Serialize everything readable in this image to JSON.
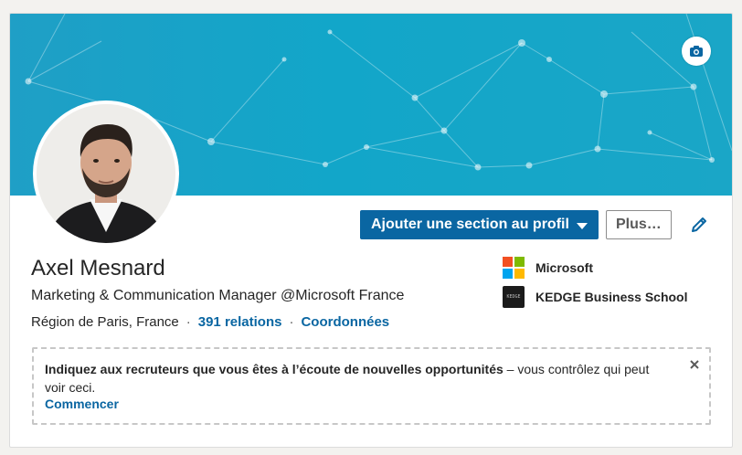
{
  "profile": {
    "name": "Axel Mesnard",
    "headline": "Marketing & Communication Manager @Microsoft France",
    "location": "Région de Paris, France",
    "relations": "391 relations",
    "contact_link": "Coordonnées",
    "separator": "·"
  },
  "actions": {
    "add_section_label": "Ajouter une section au profil",
    "more_label": "Plus…"
  },
  "companies": [
    {
      "label": "Microsoft",
      "icon": "microsoft-logo-icon"
    },
    {
      "label": "KEDGE Business School",
      "icon": "kedge-logo-icon",
      "logo_text": "KEDGE"
    }
  ],
  "opportunities": {
    "bold_text": "Indiquez aux recruteurs que vous êtes à l’écoute de nouvelles opportunités",
    "rest_text": " – vous contrôlez qui peut voir ceci.",
    "cta": "Commencer"
  },
  "colors": {
    "accent": "#0a66a2",
    "banner": "#1aa6c7",
    "ms_red": "#f25022",
    "ms_green": "#7fba00",
    "ms_blue": "#00a4ef",
    "ms_yellow": "#ffb900"
  }
}
